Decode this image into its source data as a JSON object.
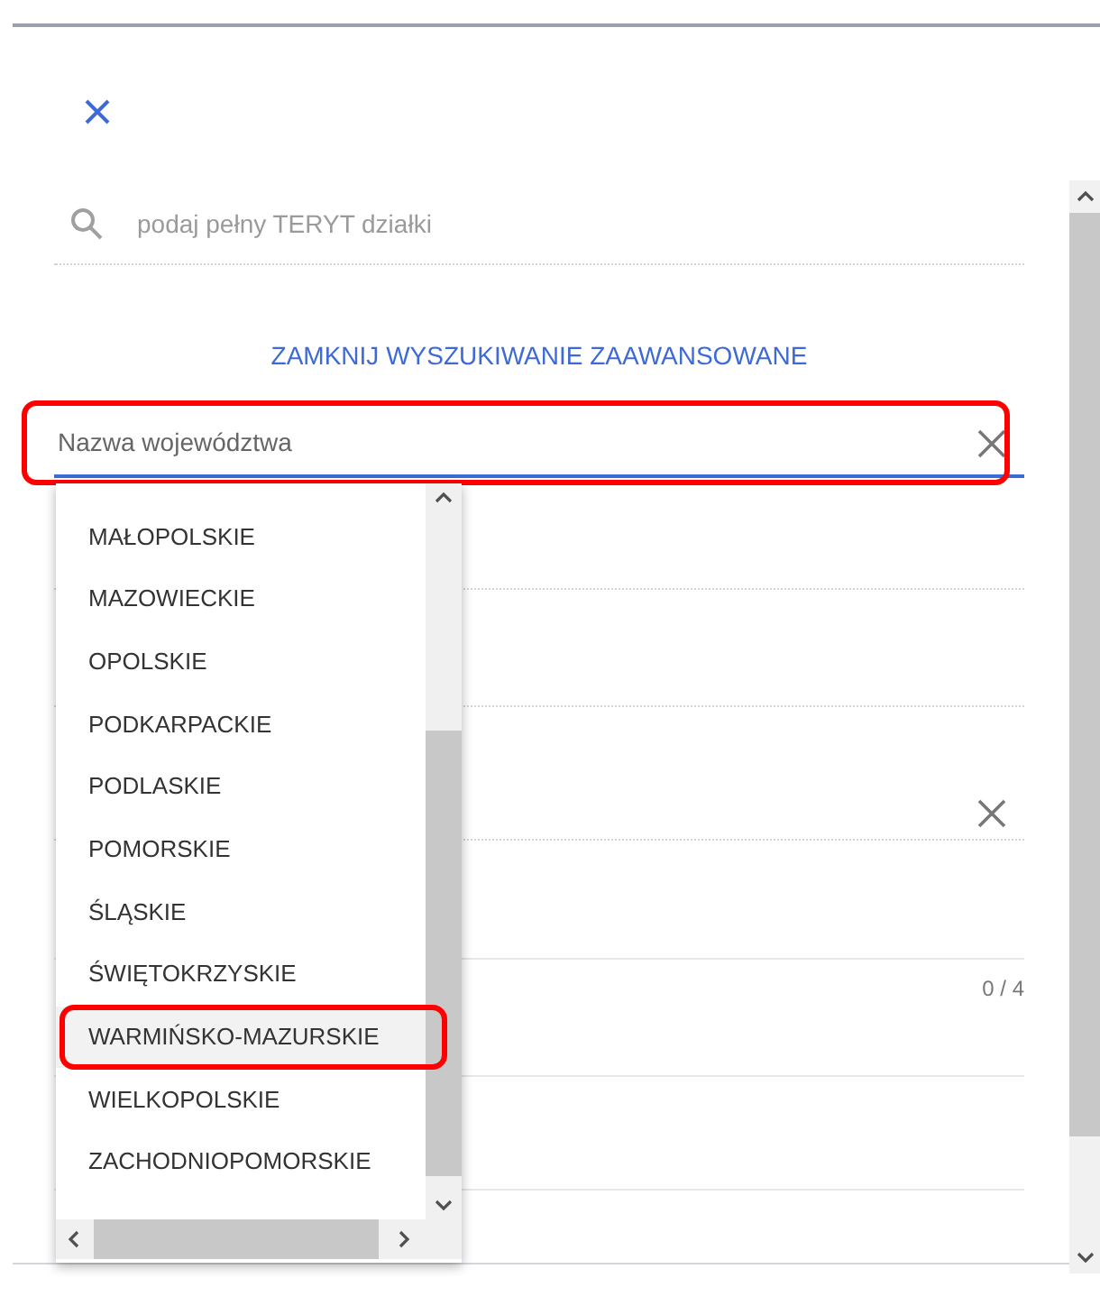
{
  "search": {
    "placeholder": "podaj pełny TERYT działki"
  },
  "advanced_link": "ZAMKNIJ WYSZUKIWANIE ZAAWANSOWANE",
  "province_field": {
    "placeholder": "Nazwa województwa",
    "annotated": true
  },
  "counter": "0 / 4",
  "options": [
    {
      "label": "MAŁOPOLSKIE",
      "selected": false,
      "annotated": false
    },
    {
      "label": "MAZOWIECKIE",
      "selected": false,
      "annotated": false
    },
    {
      "label": "OPOLSKIE",
      "selected": false,
      "annotated": false
    },
    {
      "label": "PODKARPACKIE",
      "selected": false,
      "annotated": false
    },
    {
      "label": "PODLASKIE",
      "selected": false,
      "annotated": false
    },
    {
      "label": "POMORSKIE",
      "selected": false,
      "annotated": false
    },
    {
      "label": "ŚLĄSKIE",
      "selected": false,
      "annotated": false
    },
    {
      "label": "ŚWIĘTOKRZYSKIE",
      "selected": false,
      "annotated": false
    },
    {
      "label": "WARMIŃSKO-MAZURSKIE",
      "selected": true,
      "annotated": true
    },
    {
      "label": "WIELKOPOLSKIE",
      "selected": false,
      "annotated": false
    },
    {
      "label": "ZACHODNIOPOMORSKIE",
      "selected": false,
      "annotated": false
    }
  ]
}
